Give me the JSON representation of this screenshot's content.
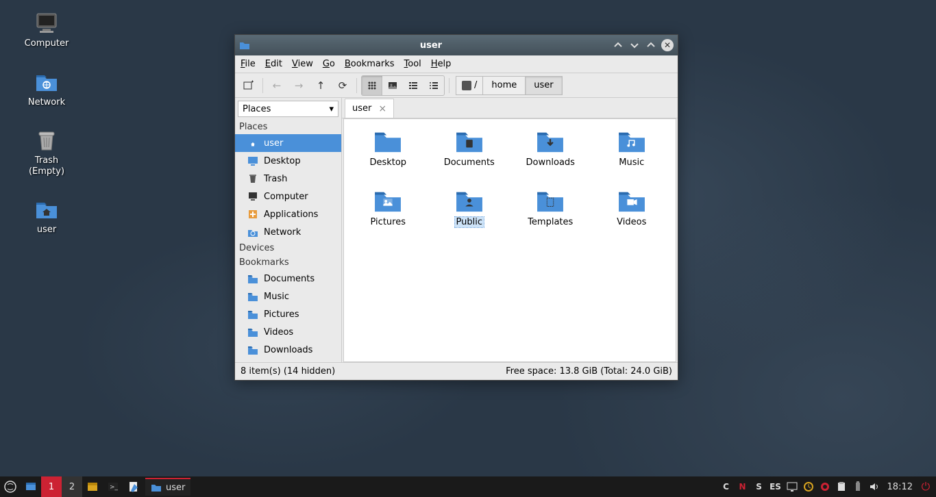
{
  "desktop": {
    "icons": [
      {
        "name": "Computer",
        "icon": "computer"
      },
      {
        "name": "Network",
        "icon": "network"
      },
      {
        "name": "Trash\n(Empty)",
        "icon": "trash"
      },
      {
        "name": "user",
        "icon": "home"
      }
    ]
  },
  "window": {
    "title": "user",
    "menus": [
      "File",
      "Edit",
      "View",
      "Go",
      "Bookmarks",
      "Tool",
      "Help"
    ],
    "path_segments": [
      "/",
      "home",
      "user"
    ],
    "active_path_segment": "user",
    "sidebar_selector": "Places",
    "sidebar": {
      "places_header": "Places",
      "places": [
        {
          "label": "user",
          "icon": "home",
          "active": true
        },
        {
          "label": "Desktop",
          "icon": "desktop"
        },
        {
          "label": "Trash",
          "icon": "trash"
        },
        {
          "label": "Computer",
          "icon": "computer"
        },
        {
          "label": "Applications",
          "icon": "apps"
        },
        {
          "label": "Network",
          "icon": "network"
        }
      ],
      "devices_header": "Devices",
      "bookmarks_header": "Bookmarks",
      "bookmarks": [
        {
          "label": "Documents",
          "icon": "folder"
        },
        {
          "label": "Music",
          "icon": "folder"
        },
        {
          "label": "Pictures",
          "icon": "folder"
        },
        {
          "label": "Videos",
          "icon": "folder"
        },
        {
          "label": "Downloads",
          "icon": "folder"
        }
      ]
    },
    "tab": {
      "label": "user"
    },
    "files": [
      {
        "label": "Desktop",
        "emblem": ""
      },
      {
        "label": "Documents",
        "emblem": "doc"
      },
      {
        "label": "Downloads",
        "emblem": "down"
      },
      {
        "label": "Music",
        "emblem": "music"
      },
      {
        "label": "Pictures",
        "emblem": "pic"
      },
      {
        "label": "Public",
        "emblem": "public",
        "selected": true
      },
      {
        "label": "Templates",
        "emblem": "tpl"
      },
      {
        "label": "Videos",
        "emblem": "vid"
      }
    ],
    "status_left": "8 item(s) (14 hidden)",
    "status_right": "Free space: 13.8 GiB (Total: 24.0 GiB)"
  },
  "taskbar": {
    "workspaces": [
      "1",
      "2"
    ],
    "active_workspace": "1",
    "task_label": "user",
    "tray_letters": [
      "C",
      "N",
      "S"
    ],
    "keyboard_layout": "ES",
    "clock": "18:12"
  }
}
